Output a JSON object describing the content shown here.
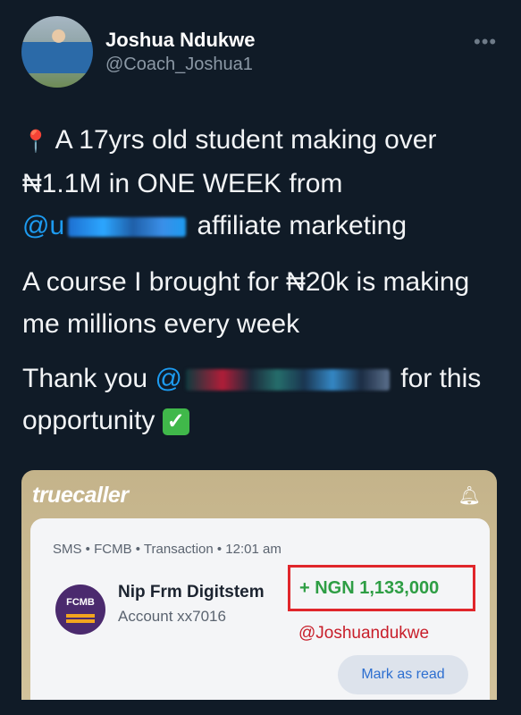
{
  "tweet": {
    "display_name": "Joshua Ndukwe",
    "handle": "@Coach_Joshua1",
    "more_icon": "more-horizontal-icon",
    "para1": {
      "pin_icon": "📍",
      "line1": "A 17yrs old student making over",
      "line2": "₦1.1M in ONE WEEK from",
      "mention_start": "@u",
      "after_mention": "affiliate marketing"
    },
    "para2": "A course I brought for ₦20k is making me millions every week",
    "para3": {
      "before": "Thank you",
      "mention_start": "@",
      "after": "for this opportunity",
      "check_icon": "✓"
    }
  },
  "notification": {
    "app_logo": "truecaller",
    "bell_icon": "bell-icon",
    "header": "SMS • FCMB • Transaction • 12:01 am",
    "bank_logo": "FCMB",
    "sender": "Nip Frm Digitstem",
    "account": "Account xx7016",
    "amount": "+ NGN 1,133,000",
    "watermark": "@Joshuandukwe",
    "mark_as_read": "Mark as read"
  },
  "colors": {
    "background": "#101b27",
    "mention": "#1d9bf0",
    "amount": "#2e9e44",
    "highlight_box": "#e0262b"
  }
}
